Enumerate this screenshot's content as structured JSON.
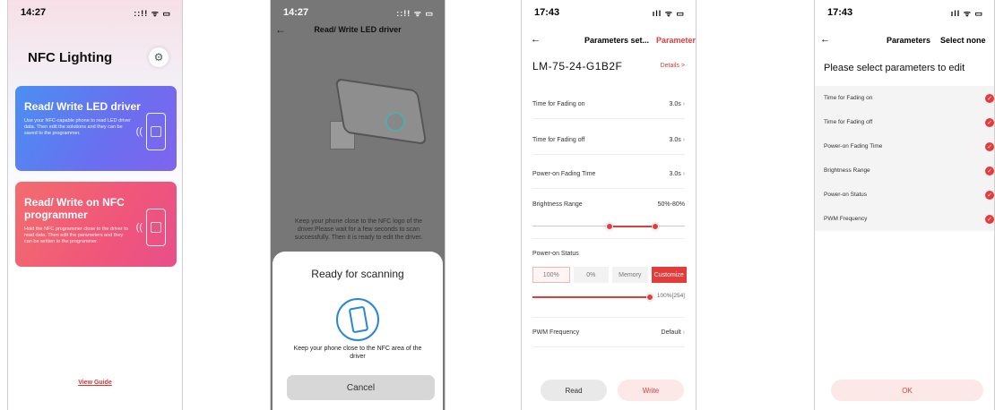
{
  "screen1": {
    "time": "14:27",
    "status_icons": "::!! ᯤ ▭",
    "title": "NFC Lighting",
    "settings_icon": "gear-icon",
    "card1": {
      "title": "Read/ Write LED driver",
      "desc": "Use your NFC-capable phone to read LED driver data. Then edit the solutions and they can be saved to the programmer.",
      "color": "#6b6ef0"
    },
    "card2": {
      "title": "Read/ Write on NFC programmer",
      "desc": "Hold the NFC programmer close to the driver to read data. Then edit the parameters and they can be written to the programmer.",
      "color": "#f0567a"
    },
    "guide": "View Guide"
  },
  "screen2": {
    "time": "14:27",
    "status_icons": "::!! ᯤ ▭",
    "title": "Read/ Write LED driver",
    "instructions": "Keep your phone close to the NFC logo of the driver.Please wait for a few seconds to scan successfully. Then it is ready to edit the driver.",
    "sheet_title": "Ready for scanning",
    "sheet_message": "Keep your phone close to the NFC area of the driver",
    "cancel": "Cancel"
  },
  "screen3": {
    "time": "17:43",
    "status_icons": "ıll ᯤ ▭",
    "nav_title": "Parameters set...",
    "nav_tab": "Parameters",
    "model": "LM-75-24-G1B2F",
    "details": "Details >",
    "rows": [
      {
        "label": "Time for Fading on",
        "value": "3.0s"
      },
      {
        "label": "Time for Fading off",
        "value": "3.0s"
      },
      {
        "label": "Power-on Fading Time",
        "value": "3.0s"
      }
    ],
    "brightness": {
      "label": "Brightness Range",
      "value": "50%-80%",
      "low": 0.5,
      "high": 0.8
    },
    "power_on": {
      "label": "Power-on Status",
      "options": [
        "100%",
        "0%",
        "Memory",
        "Customize"
      ],
      "slider_value": "100%[254]",
      "level": 1.0
    },
    "pwm": {
      "label": "PWM Frequency",
      "value": "Default"
    },
    "read": "Read",
    "write": "Write",
    "accent": "#e43b3b"
  },
  "screen4": {
    "time": "17:43",
    "status_icons": "ıll ᯤ ▭",
    "nav_title": "Parameters",
    "nav_action": "Select none",
    "prompt": "Please select parameters to edit",
    "items": [
      "Time for Fading on",
      "Time for Fading off",
      "Power-on Fading Time",
      "Brightness Range",
      "Power-on Status",
      "PWM Frequency"
    ],
    "check": "✓",
    "ok": "OK"
  }
}
